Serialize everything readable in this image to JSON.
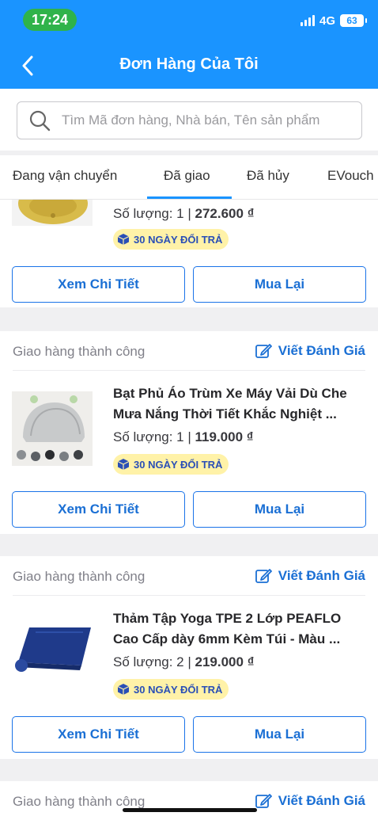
{
  "status_bar": {
    "time": "17:24",
    "network": "4G",
    "battery": "63"
  },
  "header": {
    "title": "Đơn Hàng Của Tôi"
  },
  "search": {
    "placeholder": "Tìm Mã đơn hàng, Nhà bán, Tên sản phẩm"
  },
  "tabs": [
    {
      "label": "Đang vận chuyển",
      "active": false
    },
    {
      "label": "Đã giao",
      "active": true
    },
    {
      "label": "Đã hủy",
      "active": false
    },
    {
      "label": "EVouch",
      "active": false
    }
  ],
  "orders": [
    {
      "status": "",
      "review_label": "",
      "name": "",
      "quantity_label": "Số lượng: 1",
      "price": "272.600 ₫",
      "badge": "30 NGÀY ĐỔI TRẢ",
      "detail_button": "Xem Chi Tiết",
      "rebuy_button": "Mua Lại"
    },
    {
      "status": "Giao hàng thành công",
      "review_label": "Viết Đánh Giá",
      "name": "Bạt Phủ Áo Trùm Xe Máy Vải Dù Che Mưa Nắng Thời Tiết Khắc Nghiệt ...",
      "quantity_label": "Số lượng: 1",
      "price": "119.000 ₫",
      "badge": "30 NGÀY ĐỔI TRẢ",
      "detail_button": "Xem Chi Tiết",
      "rebuy_button": "Mua Lại"
    },
    {
      "status": "Giao hàng thành công",
      "review_label": "Viết Đánh Giá",
      "name": "Thảm Tập Yoga TPE 2 Lớp PEAFLO Cao Cấp dày 6mm Kèm Túi - Màu ...",
      "quantity_label": "Số lượng: 2",
      "price": "219.000 ₫",
      "badge": "30 NGÀY ĐỔI TRẢ",
      "detail_button": "Xem Chi Tiết",
      "rebuy_button": "Mua Lại"
    },
    {
      "status": "Giao hàng thành công",
      "review_label": "Viết Đánh Giá"
    }
  ],
  "colors": {
    "primary": "#1a94ff",
    "link": "#1a6fd4",
    "badge_bg": "#fff2a8",
    "status_time_bg": "#2fb34a"
  }
}
